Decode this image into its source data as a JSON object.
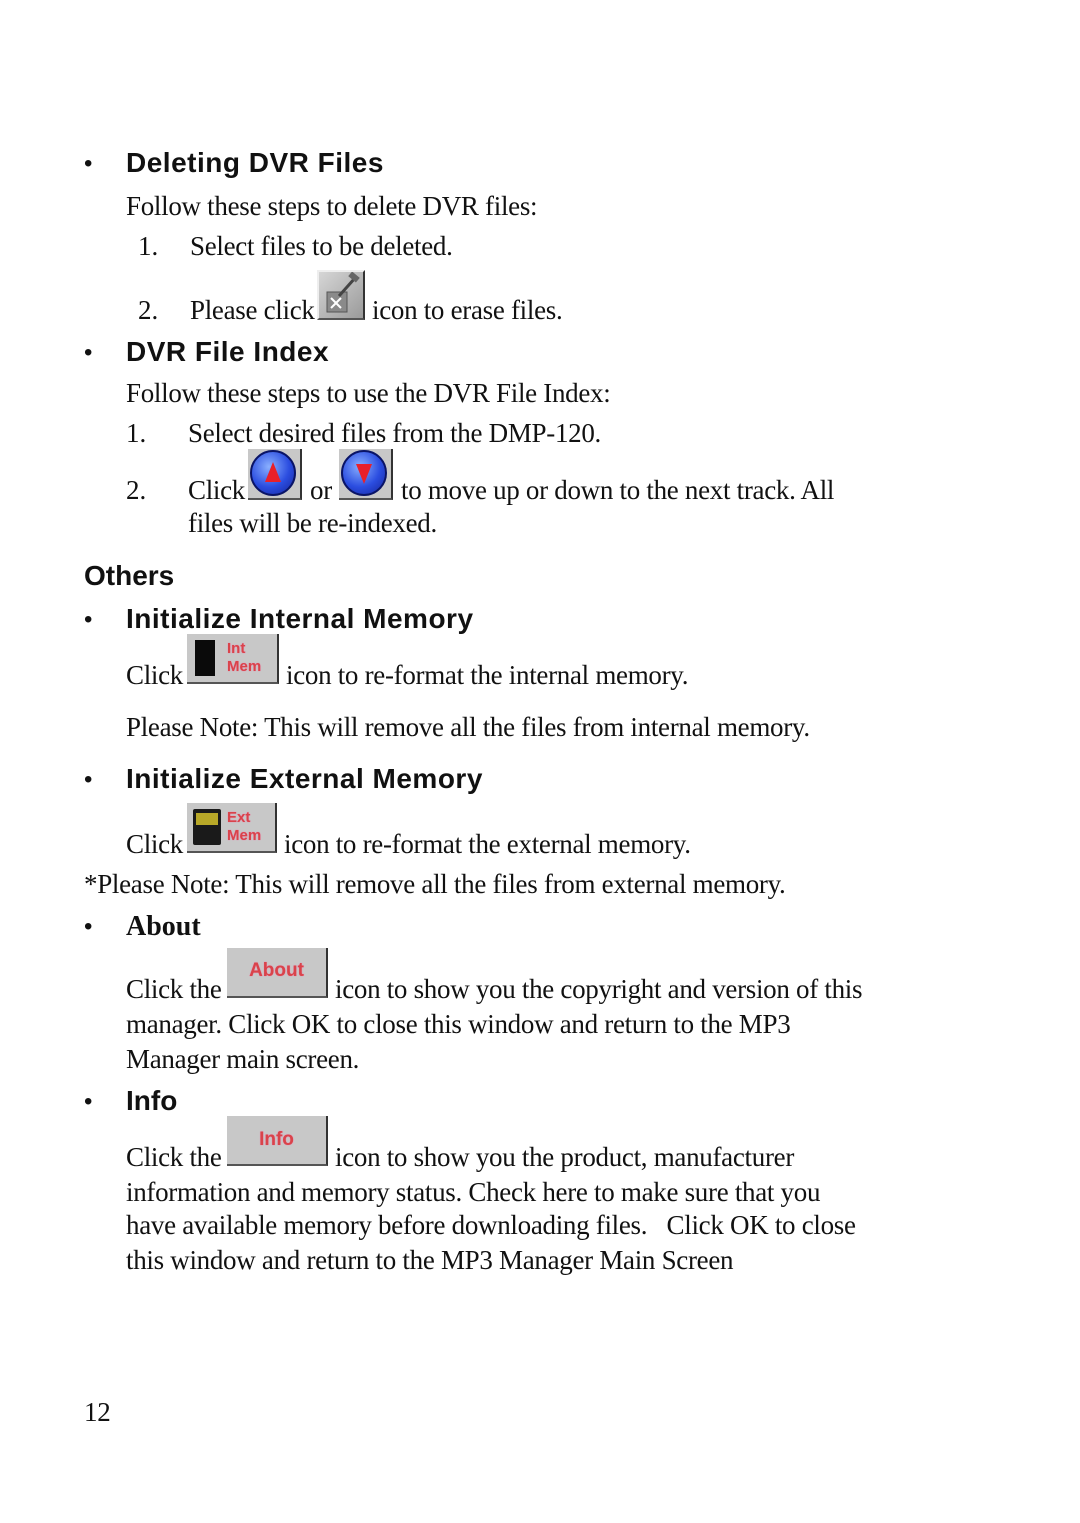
{
  "sections": {
    "deleting": {
      "heading": "Deleting DVR Files",
      "intro": "Follow these steps to delete DVR files:",
      "steps": [
        {
          "num": "1.",
          "text": "Select files to be deleted."
        },
        {
          "num": "2.",
          "text_before": "Please click",
          "icon": "erase-icon",
          "text_after": "icon to erase files."
        }
      ]
    },
    "file_index": {
      "heading": "DVR File Index",
      "intro": "Follow these steps to use the DVR File Index:",
      "steps": [
        {
          "num": "1.",
          "text": "Select desired files from the DMP-120."
        },
        {
          "num": "2.",
          "text_before": "Click",
          "icon_up": "move-up-icon",
          "middle": "or",
          "icon_down": "move-down-icon",
          "text_after": "to move up or down to the next track. All",
          "continuation": "files will be re-indexed."
        }
      ]
    },
    "others": {
      "heading": "Others"
    },
    "init_internal": {
      "heading": "Initialize Internal Memory",
      "text_before": "Click",
      "icon_label_1": "Int",
      "icon_label_2": "Mem",
      "text_after": "icon to re-format the internal memory.",
      "note": "Please Note: This will remove all the files from internal memory."
    },
    "init_external": {
      "heading": "Initialize External Memory",
      "text_before": "Click",
      "icon_label_1": "Ext",
      "icon_label_2": "Mem",
      "text_after": "icon to re-format the external memory.",
      "note": "*Please Note: This will remove all the files from external memory."
    },
    "about": {
      "heading": "About",
      "text_before": "Click the",
      "icon_label": "About",
      "line1": "icon to show you the copyright and version of this",
      "line2": "manager. Click OK to close this window and return to the MP3",
      "line3": "Manager main screen."
    },
    "info": {
      "heading": "Info",
      "text_before": "Click the",
      "icon_label": "Info",
      "line1": "icon to show you the product, manufacturer",
      "line2": "information and memory status. Check here to make sure that you",
      "line3": "have available memory before downloading files.   Click OK to close",
      "line4": "this window and return to the MP3 Manager Main Screen"
    }
  },
  "bullet_glyph": "•",
  "page_number": "12"
}
